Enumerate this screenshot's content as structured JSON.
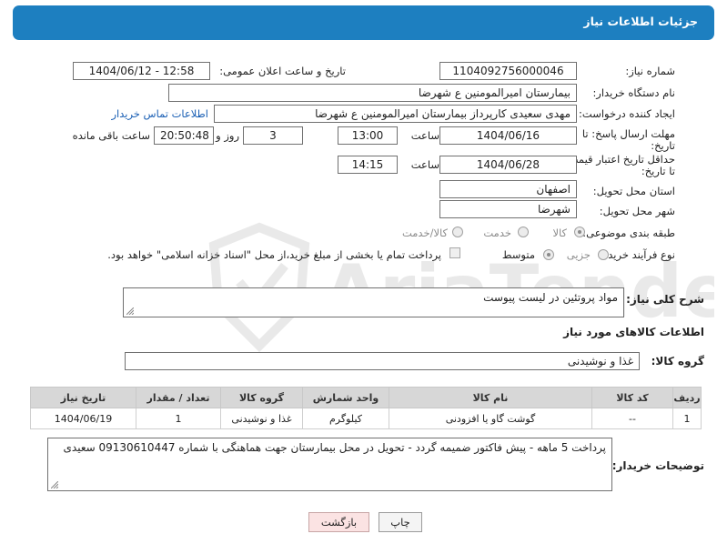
{
  "header": {
    "title": "جزئیات اطلاعات نیاز"
  },
  "fields": {
    "need_number_label": "شماره نیاز:",
    "need_number": "1104092756000046",
    "announce_label": "تاریخ و ساعت اعلان عمومی:",
    "announce_value": "1404/06/12 - 12:58",
    "buyer_org_label": "نام دستگاه خریدار:",
    "buyer_org": "بیمارستان امیرالمومنین ع  شهرضا",
    "creator_label": "ایجاد کننده درخواست:",
    "creator": "مهدی سعیدی کارپرداز بیمارستان امیرالمومنین ع  شهرضا",
    "contact_link": "اطلاعات تماس خریدار",
    "deadline_label_1": "مهلت ارسال پاسخ: تا",
    "deadline_label_2": "تاریخ:",
    "deadline_date": "1404/06/16",
    "time_label": "ساعت",
    "deadline_time": "13:00",
    "days_value": "3",
    "days_label": "روز و",
    "remaining_value": "20:50:48",
    "remaining_label": "ساعت باقی مانده",
    "price_label_1": "حداقل تاریخ اعتبار قیمت:",
    "price_label_2": "تا تاریخ:",
    "price_date": "1404/06/28",
    "price_time_label": "ساعت",
    "price_time": "14:15",
    "province_label": "استان محل تحویل:",
    "province": "اصفهان",
    "city_label": "شهر محل تحویل:",
    "city": "شهرضا",
    "category_label": "طبقه بندی موضوعی:",
    "category_options": [
      "کالا",
      "خدمت",
      "کالا/خدمت"
    ],
    "process_label": "نوع فرآیند خرید :",
    "process_options": [
      "جزیی",
      "متوسط"
    ],
    "payment_note": "پرداخت تمام یا بخشی از مبلغ خرید،از محل \"اسناد خزانه اسلامی\" خواهد بود."
  },
  "summary": {
    "label": "شرح کلی نیاز:",
    "value": "مواد پروتئین در لیست پیوست"
  },
  "goods": {
    "section_title": "اطلاعات کالاهای مورد نیاز",
    "group_label": "گروه کالا:",
    "group_value": "غذا و نوشیدنی",
    "columns": [
      "ردیف",
      "کد کالا",
      "نام کالا",
      "واحد شمارش",
      "گروه کالا",
      "تعداد / مقدار",
      "تاریخ نیاز"
    ],
    "rows": [
      [
        "1",
        "--",
        "گوشت گاو یا افزودنی",
        "کیلوگرم",
        "غذا و نوشیدنی",
        "1",
        "1404/06/19"
      ]
    ]
  },
  "buyer_notes": {
    "label": "توضیحات خریدار:",
    "value": "پرداخت 5 ماهه - پیش فاکتور ضمیمه گردد - تحویل در محل بیمارستان جهت هماهنگی با شماره 09130610447 سعیدی"
  },
  "buttons": {
    "print": "چاپ",
    "back": "بازگشت"
  },
  "colors": {
    "header_bg": "#1d7fc0",
    "link": "#1a5fb4",
    "back_button_bg": "#fbe3e3"
  },
  "watermark": {
    "text": "AriaTender.net"
  }
}
